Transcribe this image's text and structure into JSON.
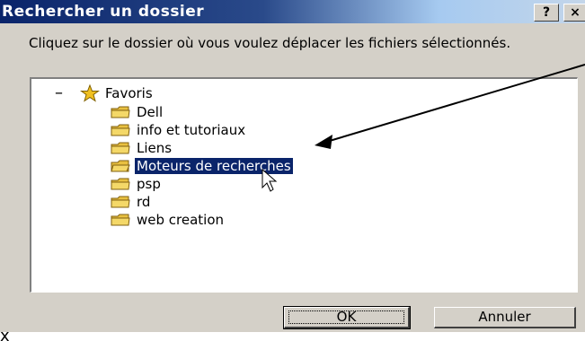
{
  "window": {
    "title": "Rechercher un dossier",
    "help_label": "?",
    "close_label": "×"
  },
  "dialog": {
    "instruction": "Cliquez sur le dossier où vous voulez déplacer les fichiers sélectionnés."
  },
  "tree": {
    "root": {
      "expander": "–",
      "label": "Favoris",
      "icon": "star-icon"
    },
    "items": [
      {
        "label": "Dell",
        "icon": "folder-icon"
      },
      {
        "label": "info et tutoriaux",
        "icon": "folder-icon"
      },
      {
        "label": "Liens",
        "icon": "folder-icon"
      },
      {
        "label": "Moteurs de recherches",
        "icon": "folder-icon",
        "selected": true
      },
      {
        "label": "psp",
        "icon": "folder-icon"
      },
      {
        "label": "rd",
        "icon": "folder-icon"
      },
      {
        "label": "web creation",
        "icon": "folder-icon"
      }
    ]
  },
  "buttons": {
    "ok_label": "OK",
    "cancel_label": "Annuler"
  },
  "fragment": {
    "text": "x"
  },
  "colors": {
    "selection": "#0a246a",
    "dialog_face": "#d4d0c8",
    "arrow": "#000000",
    "folder": "#e8c040"
  }
}
